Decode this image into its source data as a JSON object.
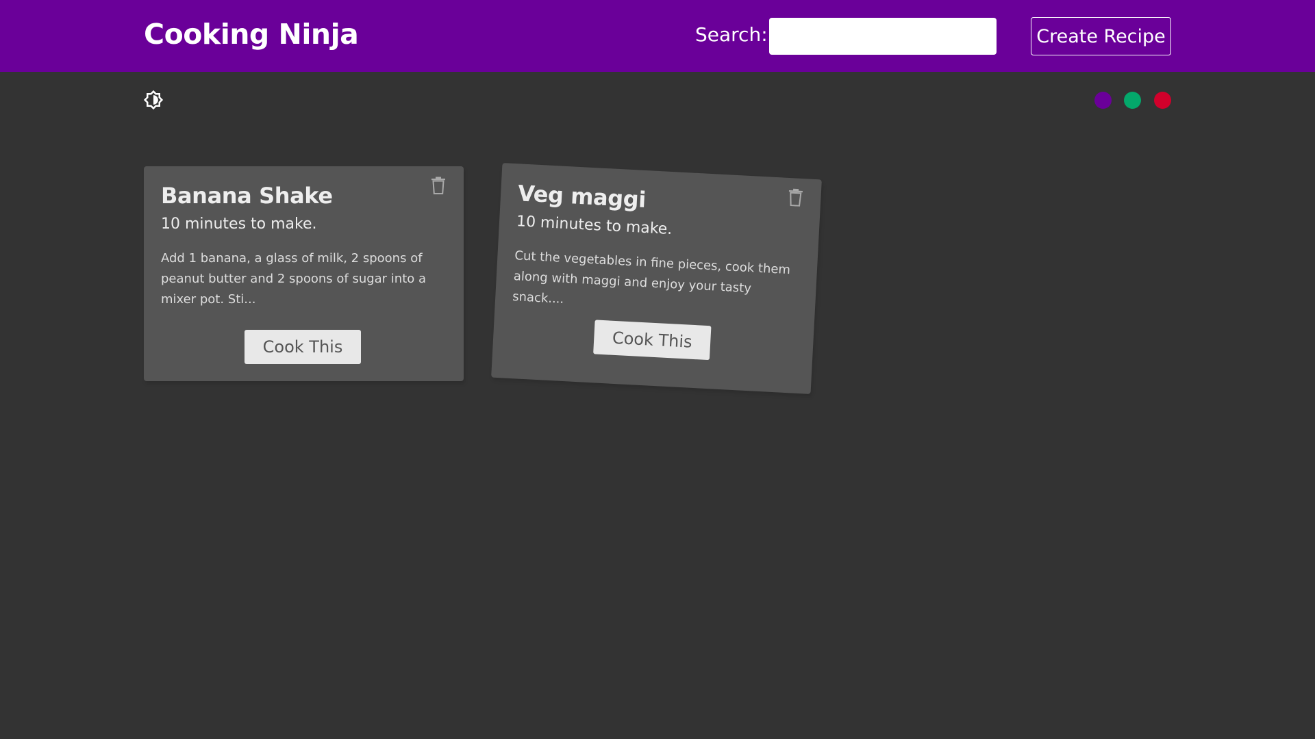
{
  "colors": {
    "navbar": "#6a0099",
    "background": "#333333",
    "card": "#555555",
    "swatches": [
      "#6a0099",
      "#04a86b",
      "#d1002b"
    ]
  },
  "navbar": {
    "brand": "Cooking Ninja",
    "search_label": "Search:",
    "search_value": "",
    "create_label": "Create Recipe"
  },
  "toolbar": {
    "mode_icon": "brightness-toggle-icon"
  },
  "recipes": [
    {
      "title": "Banana Shake",
      "time": "10 minutes to make.",
      "description": "Add 1 banana, a glass of milk, 2 spoons of peanut butter and 2 spoons of sugar into a mixer pot. Sti...",
      "button": "Cook This",
      "delete_icon": "trash-icon"
    },
    {
      "title": "Veg maggi",
      "time": "10 minutes to make.",
      "description": "Cut the vegetables in fine pieces, cook them along with maggi and enjoy your tasty snack....",
      "button": "Cook This",
      "delete_icon": "trash-icon"
    }
  ]
}
